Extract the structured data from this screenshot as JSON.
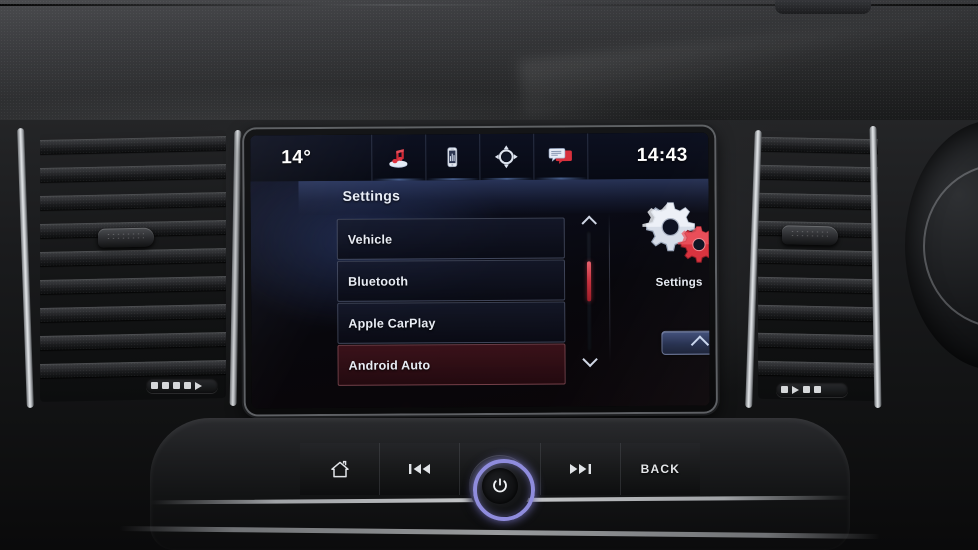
{
  "screen": {
    "status_bar": {
      "temperature": "14°",
      "clock": "14:43",
      "icons": [
        {
          "name": "audio-icon",
          "label": "Audio"
        },
        {
          "name": "phone-icon",
          "label": "Phone"
        },
        {
          "name": "navigation-icon",
          "label": "Navigation"
        },
        {
          "name": "messages-icon",
          "label": "Messages"
        }
      ]
    },
    "panel": {
      "title": "Settings",
      "list_items": [
        {
          "label": "Vehicle",
          "highlighted": false
        },
        {
          "label": "Bluetooth",
          "highlighted": false
        },
        {
          "label": "Apple CarPlay",
          "highlighted": false
        },
        {
          "label": "Android Auto",
          "highlighted": true
        }
      ],
      "scrollbar": {
        "up_icon": "chevron-up-icon",
        "down_icon": "chevron-down-icon",
        "thumb_color": "#c8313f"
      },
      "tile": {
        "caption": "Settings",
        "icon": "gears-icon"
      },
      "up_button": {
        "icon": "chevron-up-icon"
      }
    }
  },
  "hardware_buttons": [
    {
      "name": "home-button",
      "icon": "home-icon",
      "label": ""
    },
    {
      "name": "previous-track-button",
      "icon": "previous-track-icon",
      "label": ""
    },
    {
      "name": "next-track-button",
      "icon": "next-track-icon",
      "label": ""
    },
    {
      "name": "back-button",
      "icon": "",
      "label": "BACK"
    }
  ],
  "power_knob": {
    "name": "power-volume-knob",
    "icon": "power-icon",
    "ring_color": "#8f8cdd"
  },
  "colors": {
    "accent_red": "#c8313f",
    "accent_blue": "#4a5c8e",
    "knob_purple": "#8f8cdd",
    "screen_bg": "#07090f"
  }
}
